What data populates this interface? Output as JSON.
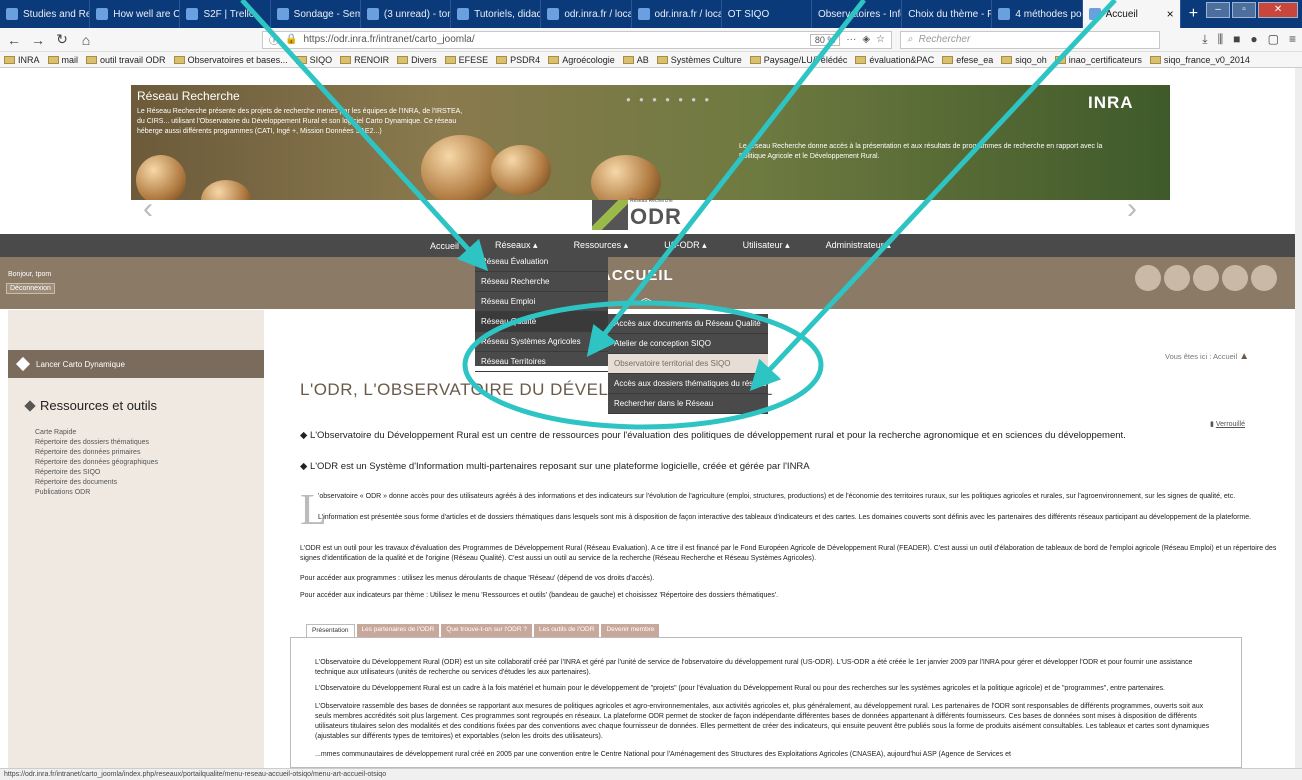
{
  "browser": {
    "tabs": [
      {
        "label": "Studies and Repo"
      },
      {
        "label": "How well are CAI"
      },
      {
        "label": "S2F | Trello"
      },
      {
        "label": "Sondage - Semis"
      },
      {
        "label": "(3 unread) - tom"
      },
      {
        "label": "Tutoriels, didacti"
      },
      {
        "label": "odr.inra.fr / locali"
      },
      {
        "label": "odr.inra.fr / locali"
      },
      {
        "label": "OT SIQO"
      },
      {
        "label": "Observatoires - Inform"
      },
      {
        "label": "Choix du thème - For"
      },
      {
        "label": "4 méthodes pour"
      },
      {
        "label": "Accueil"
      }
    ],
    "close_tab": "×",
    "new_tab": "+",
    "url": "https://odr.inra.fr/intranet/carto_joomla/",
    "zoom": "80 %",
    "search_placeholder": "Rechercher",
    "bookmarks": [
      "INRA",
      "mail",
      "outil travail ODR",
      "Observatoires et bases...",
      "SIQO",
      "RENOIR",
      "Divers",
      "EFESE",
      "PSDR4",
      "Agroécologie",
      "AB",
      "Systèmes Culture",
      "Paysage/LU/Télédéc",
      "évaluation&PAC",
      "efese_ea",
      "siqo_oh",
      "inao_certificateurs",
      "siqo_france_v0_2014"
    ],
    "status": "https://odr.inra.fr/intranet/carto_joomla/index.php/reseaux/portailqualite/menu-reseau-accueil-otsiqo/menu-art-accueil-otsiqo"
  },
  "banner": {
    "title": "Réseau Recherche",
    "description": "Le Réseau Recherche présente des projets de recherche menés par les équipes de l'INRA, de l'IRSTEA, du CIRS... utilisant l'Observatoire du Développement Rural et son logiciel Carto Dynamique. Ce réseau héberge aussi différents programmes (CATI, Ingé +, Mission Données SAE2...)",
    "right_text": "Le réseau Recherche donne accès à la présentation et aux résultats de programmes de recherche en rapport avec la Politique Agricole et le Développement Rural.",
    "inra": "INRA",
    "logo_small": "Réseau Recherche",
    "logo": "ODR"
  },
  "menu": {
    "items": [
      "Accueil",
      "Réseaux ▴",
      "Ressources ▴",
      "US-ODR ▴",
      "Utilisateur ▴",
      "Administrateur ▴"
    ],
    "reseaux_dropdown": [
      "Réseau Évaluation",
      "Réseau Recherche",
      "Réseau Emploi",
      "Réseau Qualité",
      "Réseau Systèmes Agricoles",
      "Réseau Territoires"
    ],
    "qualite_submenu": [
      "Accès aux documents du Réseau Qualité",
      "Atelier de conception SIQO",
      "Observatoire territorial des SIQO",
      "Accès aux dossiers thématiques du réseau",
      "Rechercher dans le Réseau"
    ]
  },
  "user": {
    "welcome": "Bonjour, tpom",
    "logout": "Déconnexion"
  },
  "header": {
    "title": "ACCUEIL",
    "breadcrumb": "Vous êtes ici : Accueil",
    "lock": "Verrouillé"
  },
  "sidebar": {
    "launch": "Lancer Carto Dynamique",
    "title": "Ressources et outils",
    "links": [
      "Carte Rapide",
      "Répertoire des dossiers thématiques",
      "Répertoire des données primaires",
      "Répertoire des données géographiques",
      "Répertoire des SIQO",
      "Répertoire des documents",
      "Publications ODR"
    ]
  },
  "content": {
    "page_title": "L'ODR, L'OBSERVATOIRE DU DÉVELOPPEMENT RURAL",
    "p1": "◆ L'Observatoire du Développement Rural est un centre de ressources pour l'évaluation des politiques de développement rural et pour la recherche agronomique et en sciences du développement.",
    "p2": "◆ L'ODR est un Système d'Information multi-partenaires reposant sur une plateforme logicielle, créée et gérée par l'INRA",
    "dropcap": "L",
    "p3": "'observatoire « ODR » donne accès pour des utilisateurs agréés à des informations et des indicateurs sur l'évolution de l'agriculture (emploi, structures, productions) et de l'économie des territoires ruraux, sur les politiques agricoles et rurales, sur l'agroenvironnement, sur les signes de qualité, etc.",
    "p4": "L'information est présentée sous forme d'articles et de dossiers thématiques dans lesquels sont mis à disposition de façon interactive des tableaux d'indicateurs et des cartes. Les domaines couverts sont définis avec les partenaires des différents réseaux participant au développement de la plateforme.",
    "p5": "L'ODR est un outil pour les travaux d'évaluation des Programmes de Développement Rural (Réseau Evaluation). A ce titre il est financé par le Fond Européen Agricole de Développement Rural (FEADER). C'est aussi un outil d'élaboration de tableaux de bord de l'emploi agricole (Réseau Emploi) et un répertoire des signes d'identification de la qualité et de l'origine (Réseau Qualité). C'est aussi un outil au service de la recherche (Réseau Recherche et Réseau Systèmes Agricoles).",
    "p6": "Pour accéder aux programmes : utilisez les menus déroulants de chaque 'Réseau' (dépend de vos droits d'accès).",
    "p7": "Pour accéder aux indicateurs par thème : Utilisez le menu 'Ressources et outils' (bandeau de gauche) et choisissez 'Répertoire des dossiers thématiques'.",
    "tabs": [
      "Présentation",
      "Les partenaires de l'ODR",
      "Que trouve-t-on sur l'ODR ?",
      "Les outils de l'ODR",
      "Devenir membre"
    ],
    "tab_p1": "L'Observatoire du Développement Rural (ODR) est un site collaboratif créé par l'INRA et géré par l'unité de service de l'observatoire du développement rural (US-ODR). L'US-ODR a été créée le 1er janvier 2009 par l'INRA pour gérer et développer l'ODR et pour fournir une assistance technique aux utilisateurs (unités de recherche ou services d'études les aux partenaires).",
    "tab_p2": "L'Observatoire du Développement Rural est un cadre à la fois matériel et humain pour le développement de \"projets\" (pour l'évaluation du Développement Rural ou pour des recherches sur les systèmes agricoles et la politique agricole) et de \"programmes\", entre partenaires.",
    "tab_p3": "L'Observatoire rassemble des bases de données se rapportant aux mesures de politiques agricoles et agro-environnementales, aux activités agricoles et, plus généralement, au développement rural. Les partenaires de l'ODR sont responsables de différents programmes, ouverts soit aux seuls membres accrédités soit plus largement. Ces programmes sont regroupés en réseaux. La plateforme ODR permet de stocker de façon indépendante différentes bases de données appartenant à différents fournisseurs. Ces bases de données sont mises à disposition de différents utilisateurs titulaires selon des modalités et des conditions fixées par des conventions avec chaque fournisseur de données. Elles permettent de créer des indicateurs, qui ensuite peuvent être publiés sous la forme de produits aisément consultables. Les tableaux et cartes sont dynamiques (ajustables sur différents types de territoires) et exportables (selon les droits des utilisateurs).",
    "tab_p4": "...mmes communautaires de développement rural créé en 2005 par une convention entre le Centre National pour l'Aménagement des Structures des Exploitations Agricoles (CNASEA), aujourd'hui ASP (Agence de Services et"
  },
  "colors": {
    "annotation": "#2ec4c4",
    "menubar": "#4a4a4a",
    "brown": "#8a7a66"
  }
}
